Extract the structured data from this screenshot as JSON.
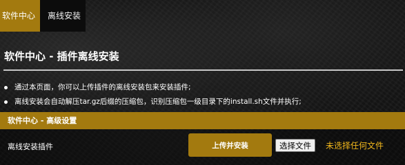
{
  "tabs": [
    {
      "label": "软件中心",
      "active": true
    },
    {
      "label": "离线安装",
      "active": false
    }
  ],
  "page_title": "软件中心 - 插件离线安装",
  "notes": [
    "通过本页面，你可以上传插件的离线安装包来安装插件;",
    "离线安装会自动解压tar.gz后缀的压缩包，识别压缩包一级目录下的install.sh文件并执行;"
  ],
  "section": {
    "title": "软件中心 - 高级设置"
  },
  "offline_install": {
    "label": "离线安装插件",
    "upload_button": "上传并安装",
    "choose_file_button": "选择文件",
    "file_status": "未选择任何文件"
  },
  "colors": {
    "accent": "#a37a0f",
    "file_status": "#f2b81c",
    "background": "#151515"
  }
}
